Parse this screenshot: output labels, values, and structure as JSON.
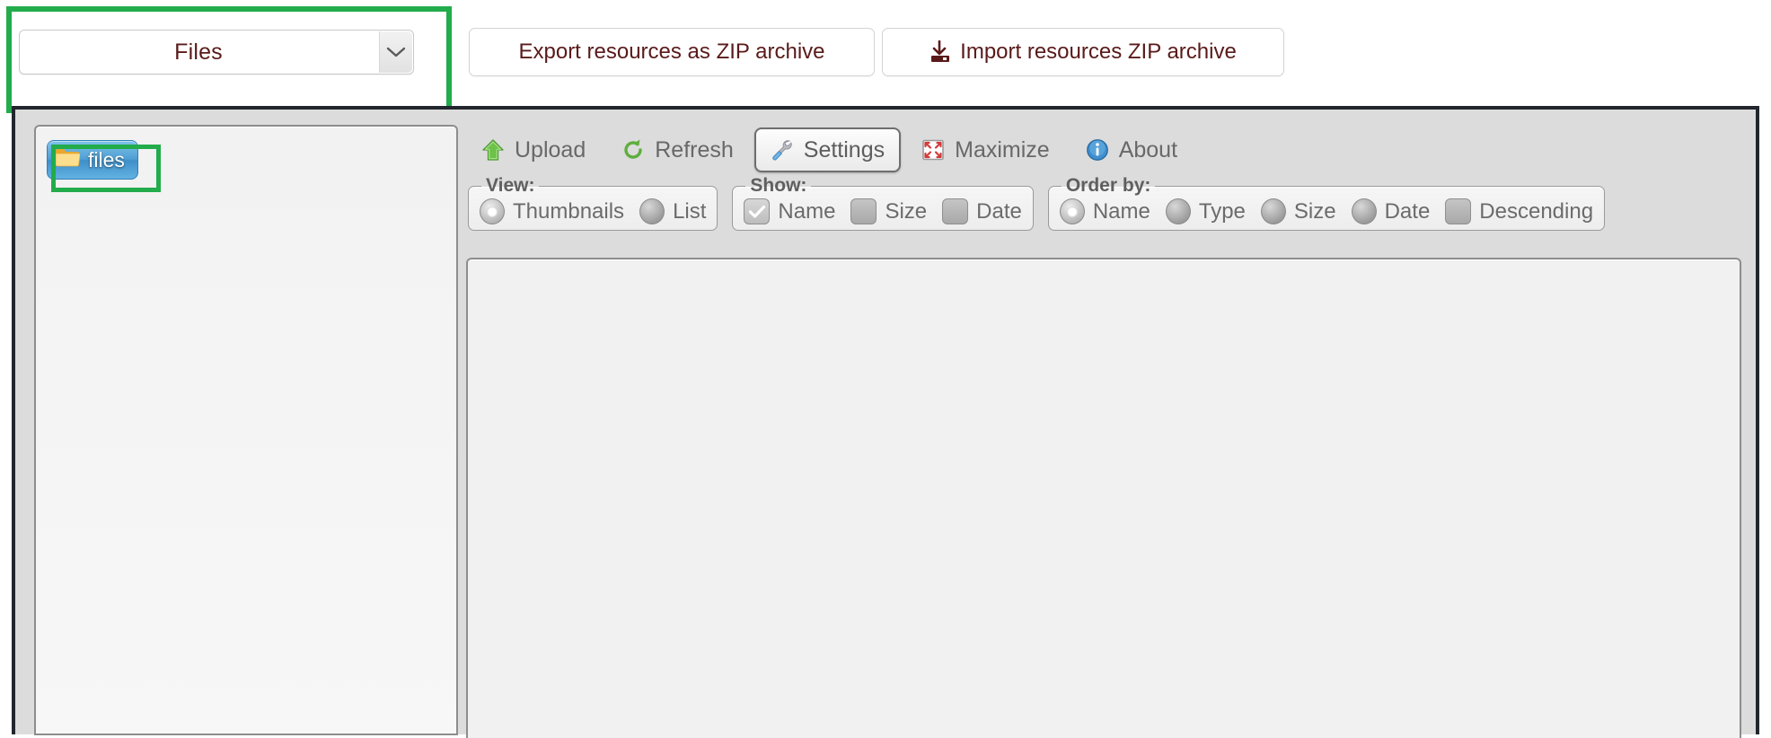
{
  "top_bar": {
    "resource_select": {
      "value": "Files",
      "options": [
        "Files"
      ],
      "arrow_icon": "chevron-down-icon"
    },
    "export_button": {
      "label": "Export resources as ZIP archive"
    },
    "import_button": {
      "label": "Import resources ZIP archive",
      "icon": "download-import-icon"
    }
  },
  "tree": {
    "items": [
      {
        "label": "files",
        "icon": "folder-icon",
        "selected": true
      }
    ]
  },
  "toolbar": {
    "buttons": [
      {
        "label": "Upload",
        "icon": "green-up-arrow-icon",
        "active": false
      },
      {
        "label": "Refresh",
        "icon": "refresh-arrow-icon",
        "active": false
      },
      {
        "label": "Settings",
        "icon": "wrench-screwdriver-icon",
        "active": true
      },
      {
        "label": "Maximize",
        "icon": "maximize-icon",
        "active": false
      },
      {
        "label": "About",
        "icon": "info-circle-icon",
        "active": false
      }
    ]
  },
  "groups": {
    "view": {
      "legend": "View:",
      "options": [
        {
          "label": "Thumbnails",
          "type": "radio",
          "checked": true
        },
        {
          "label": "List",
          "type": "radio",
          "checked": false
        }
      ]
    },
    "show": {
      "legend": "Show:",
      "options": [
        {
          "label": "Name",
          "type": "checkbox",
          "checked": true
        },
        {
          "label": "Size",
          "type": "checkbox",
          "checked": false
        },
        {
          "label": "Date",
          "type": "checkbox",
          "checked": false
        }
      ]
    },
    "order_by": {
      "legend": "Order by:",
      "options": [
        {
          "label": "Name",
          "type": "radio",
          "checked": true
        },
        {
          "label": "Type",
          "type": "radio",
          "checked": false
        },
        {
          "label": "Size",
          "type": "radio",
          "checked": false
        },
        {
          "label": "Date",
          "type": "radio",
          "checked": false
        },
        {
          "label": "Descending",
          "type": "checkbox",
          "checked": false
        }
      ]
    }
  },
  "content_pane": {
    "items": []
  },
  "colors": {
    "annotation_green": "#22ac4b",
    "link_text": "#5a1a1a",
    "frame_border": "#22262e",
    "selection_blue": "#4f9fd4"
  }
}
